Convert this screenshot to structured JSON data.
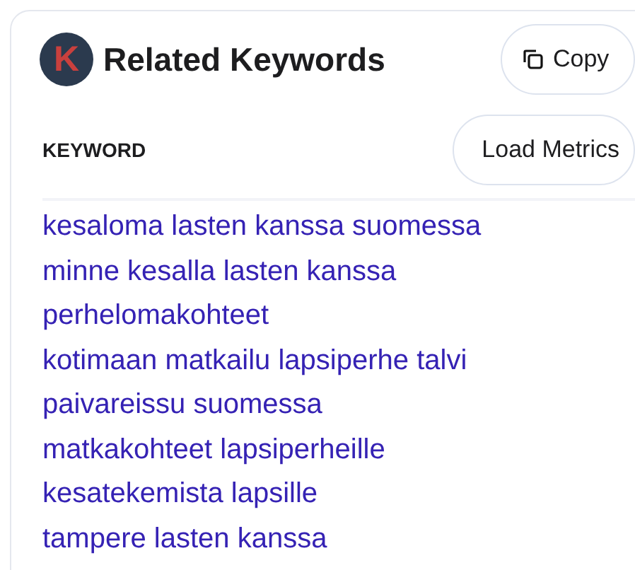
{
  "header": {
    "title": "Related Keywords",
    "logo_letter": "K",
    "copy_button": "Copy"
  },
  "table": {
    "column": "KEYWORD",
    "load_button": "Load Metrics"
  },
  "keywords": [
    "kesaloma lasten kanssa suomessa",
    "minne kesalla lasten kanssa",
    "perhelomakohteet",
    "kotimaan matkailu lapsiperhe talvi",
    "paivareissu suomessa",
    "matkakohteet lapsiperheille",
    "kesatekemista lapsille",
    "tampere lasten kanssa"
  ]
}
